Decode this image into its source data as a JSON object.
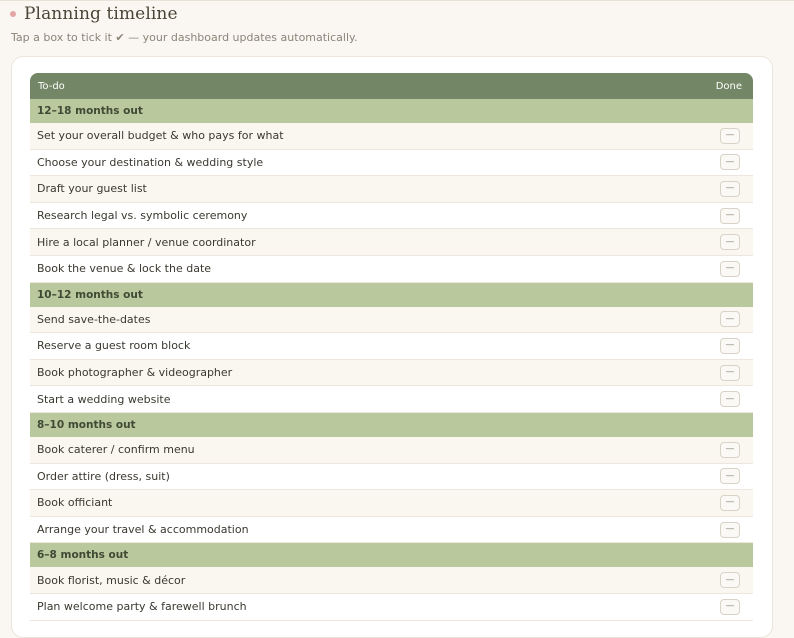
{
  "page": {
    "title": "Planning timeline",
    "subtitle": "Tap a box to tick it ✔ — your dashboard updates automatically."
  },
  "table": {
    "header_todo": "To-do",
    "header_done": "Done",
    "unchecked_glyph": "—",
    "sections": [
      {
        "label": "12–18 months out",
        "items": [
          "Set your overall budget & who pays for what",
          "Choose your destination & wedding style",
          "Draft your guest list",
          "Research legal vs. symbolic ceremony",
          "Hire a local planner / venue coordinator",
          "Book the venue & lock the date"
        ]
      },
      {
        "label": "10–12 months out",
        "items": [
          "Send save-the-dates",
          "Reserve a guest room block",
          "Book photographer & videographer",
          "Start a wedding website"
        ]
      },
      {
        "label": "8–10 months out",
        "items": [
          "Book caterer / confirm menu",
          "Order attire (dress, suit)",
          "Book officiant",
          "Arrange your travel & accommodation"
        ]
      },
      {
        "label": "6–8 months out",
        "items": [
          "Book florist, music & décor",
          "Plan welcome party & farewell brunch"
        ]
      }
    ]
  },
  "colors": {
    "header_bg": "#738665",
    "section_bg": "#bac89e",
    "accent_dot": "#e3a5a5",
    "page_bg": "#faf7f2"
  }
}
